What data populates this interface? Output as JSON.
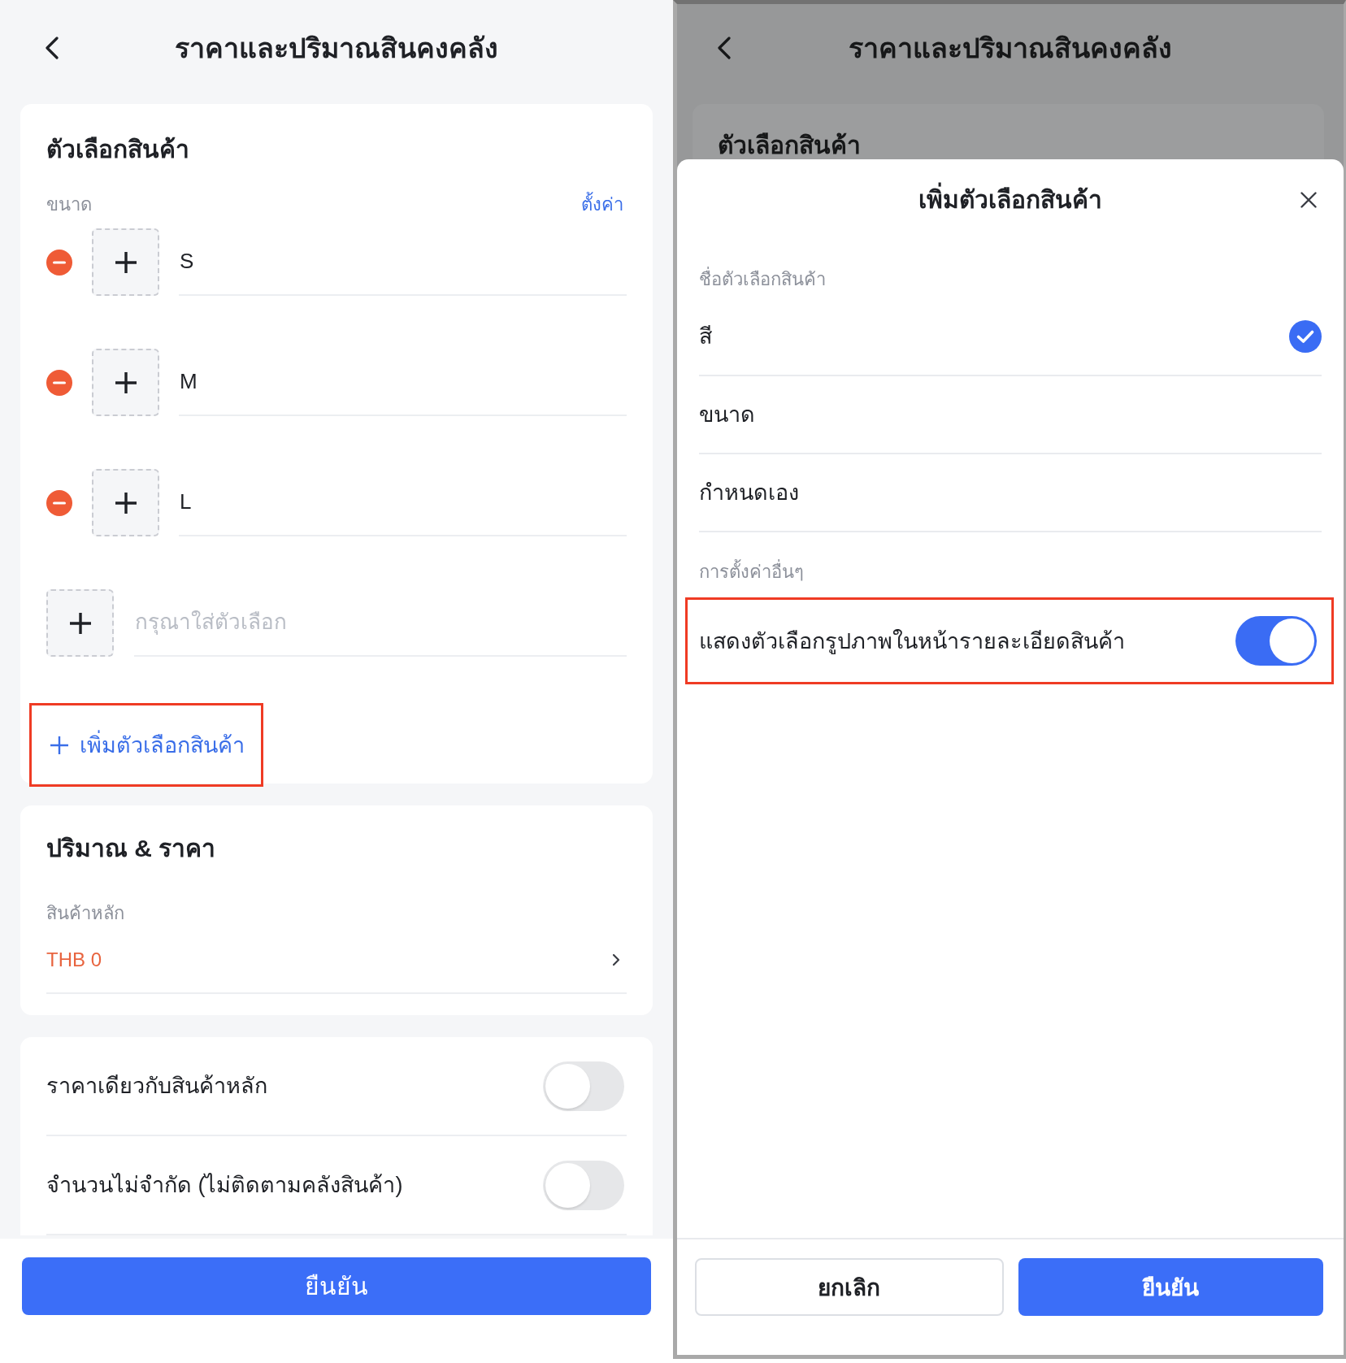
{
  "left_screen": {
    "header": {
      "title": "ราคาและปริมาณสินคงคลัง"
    },
    "variant_card": {
      "title": "ตัวเลือกสินค้า",
      "group_label": "ขนาด",
      "settings_link": "ตั้งค่า",
      "options": [
        {
          "value": "S"
        },
        {
          "value": "M"
        },
        {
          "value": "L"
        }
      ],
      "new_option": {
        "placeholder": "กรุณาใส่ตัวเลือก"
      },
      "add_variant": {
        "label": "เพิ่มตัวเลือกสินค้า",
        "highlighted": true
      }
    },
    "price_card": {
      "title": "ปริมาณ & ราคา",
      "label": "สินค้าหลัก",
      "value": "THB 0"
    },
    "switches": [
      {
        "label": "ราคาเดียวกับสินค้าหลัก",
        "on": false
      },
      {
        "label": "จำนวนไม่จำกัด (ไม่ติดตามคลังสินค้า)",
        "on": false
      }
    ],
    "confirm_button": {
      "label": "ยืนยัน"
    }
  },
  "right_screen": {
    "header": {
      "title": "ราคาและปริมาณสินคงคลัง"
    },
    "card_title": "ตัวเลือกสินค้า",
    "sheet": {
      "title": "เพิ่มตัวเลือกสินค้า",
      "name_label": "ชื่อตัวเลือกสินค้า",
      "options": [
        {
          "label": "สี",
          "selected": true
        },
        {
          "label": "ขนาด",
          "selected": false
        },
        {
          "label": "กำหนดเอง",
          "selected": false
        }
      ],
      "other_label": "การตั้งค่าอื่นๆ",
      "switches": [
        {
          "label": "แสดงตัวเลือกรูปภาพในหน้ารายละเอียดสินค้า",
          "on": true,
          "highlighted": true
        }
      ],
      "buttons": [
        {
          "label": "ยกเลิก",
          "kind": "secondary"
        },
        {
          "label": "ยืนยัน",
          "kind": "primary"
        }
      ]
    }
  }
}
